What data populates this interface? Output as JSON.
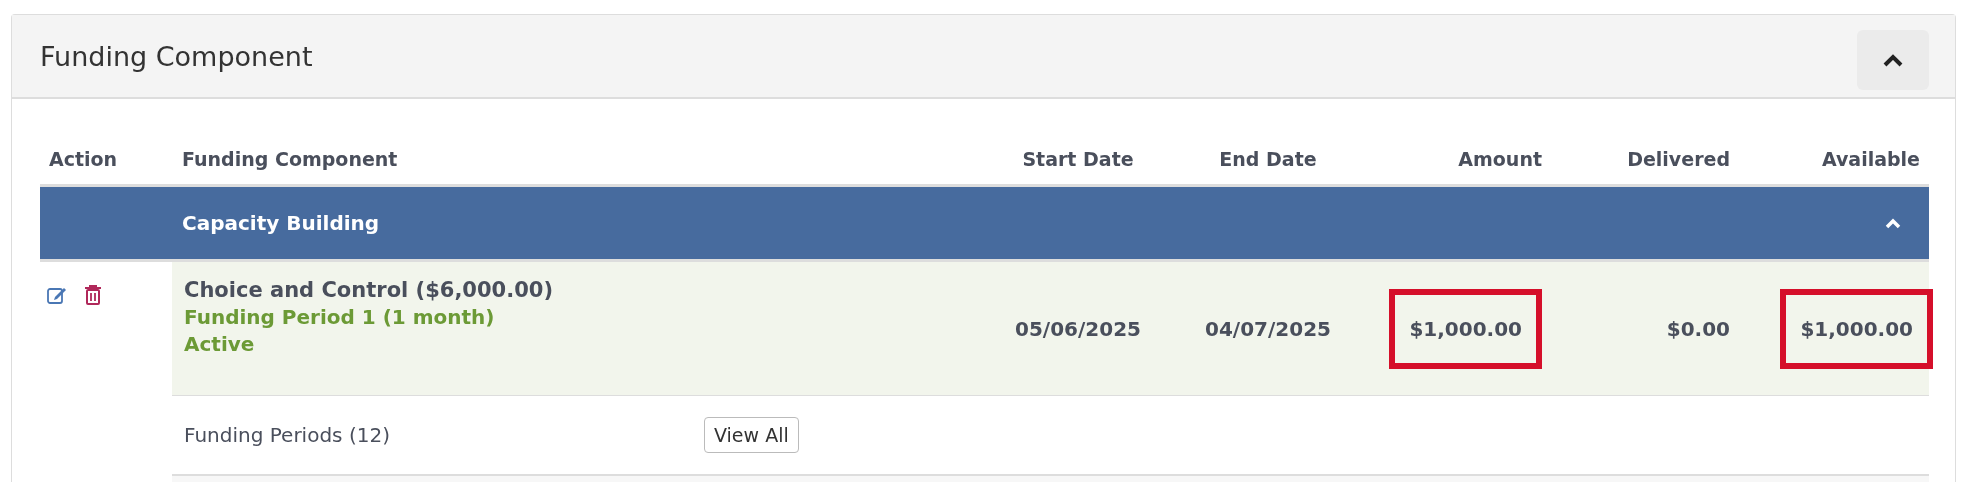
{
  "panel": {
    "title": "Funding Component",
    "expanded": true
  },
  "table": {
    "columns": [
      "Action",
      "Funding Component",
      "Start Date",
      "End Date",
      "Amount",
      "Delivered",
      "Available"
    ],
    "groups": [
      {
        "name": "Capacity Building",
        "expanded": true,
        "rows": [
          {
            "component": "Choice and Control ($6,000.00)",
            "period": "Funding Period 1 (1 month)",
            "status": "Active",
            "start_date": "05/06/2025",
            "end_date": "04/07/2025",
            "amount": "$1,000.00",
            "amount_highlighted": true,
            "delivered": "$0.00",
            "available": "$1,000.00",
            "available_highlighted": true,
            "periods_label": "Funding Periods (12)",
            "view_all": "View All"
          }
        ]
      }
    ]
  }
}
